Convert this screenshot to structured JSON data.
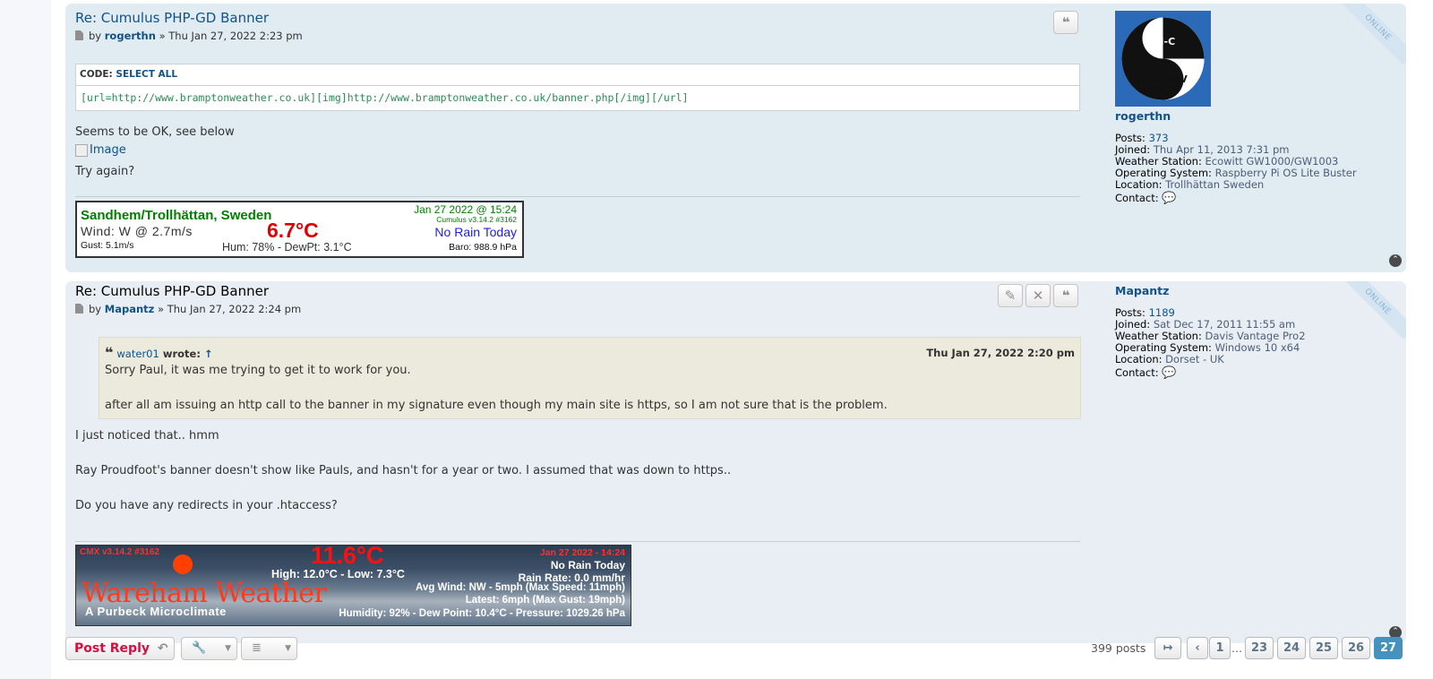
{
  "posts": [
    {
      "title": "Re: Cumulus PHP-GD Banner",
      "by": "by",
      "author": "rogerthn",
      "date": "» Thu Jan 27, 2022 2:23 pm",
      "code_label": "CODE:",
      "code_select": "SELECT ALL",
      "code": "[url=http://www.bramptonweather.co.uk][img]http://www.bramptonweather.co.uk/banner.php[/img][/url]",
      "line1": "Seems to be OK, see below",
      "image_alt": "Image",
      "line2": "Try again?",
      "banner": {
        "station": "Sandhem/Trollhättan, Sweden",
        "date": "Jan 27 2022 @ 15:24",
        "version": "Cumulus v3.14.2 #3162",
        "wind": "Wind: W @ 2.7m/s",
        "temp": "6.7°C",
        "rain": "No Rain Today",
        "gust": "Gust: 5.1m/s",
        "hum": "Hum: 78% - DewPt: 3.1°C",
        "baro": "Baro: 988.9 hPa"
      },
      "profile": {
        "username": "rogerthn",
        "avatar_top": "Ctrl-C",
        "avatar_bottom": "Ctrl-V",
        "posts_label": "Posts:",
        "posts": "373",
        "joined_label": "Joined:",
        "joined": "Thu Apr 11, 2013 7:31 pm",
        "station_label": "Weather Station:",
        "station": "Ecowitt GW1000/GW1003",
        "os_label": "Operating System:",
        "os": "Raspberry Pi OS Lite Buster",
        "location_label": "Location:",
        "location": "Trollhättan Sweden",
        "contact_label": "Contact:"
      },
      "online": "ONLINE"
    },
    {
      "title": "Re: Cumulus PHP-GD Banner",
      "by": "by",
      "author": "Mapantz",
      "date": "» Thu Jan 27, 2022 2:24 pm",
      "quote": {
        "author": "water01",
        "wrote": "wrote:",
        "arrow": "↑",
        "date": "Thu Jan 27, 2022 2:20 pm",
        "line1": "Sorry Paul, it was me trying to get it to work for you.",
        "line2": "after all am issuing an http call to the banner in my signature even though my main site is https, so I am not sure that is the problem."
      },
      "line1": "I just noticed that.. hmm",
      "line2": "Ray Proudfoot's banner doesn't show like Pauls, and hasn't for a year or two. I assumed that was down to https..",
      "line3": "Do you have any redirects in your .htaccess?",
      "banner": {
        "version": "CMX v3.14.2 #3162",
        "temp": "11.6°C",
        "date": "Jan 27 2022 - 14:24",
        "rain": "No Rain Today",
        "highlow": "High: 12.0°C - Low: 7.3°C",
        "rainrate": "Rain Rate: 0.0 mm/hr",
        "name": "Wareham Weather",
        "wind": "Avg Wind: NW - 5mph (Max Speed: 11mph)",
        "latest": "Latest: 6mph (Max Gust: 19mph)",
        "tagline": "A Purbeck Microclimate",
        "humidity": "Humidity: 92% - Dew Point: 10.4°C - Pressure: 1029.26 hPa"
      },
      "profile": {
        "username": "Mapantz",
        "posts_label": "Posts:",
        "posts": "1189",
        "joined_label": "Joined:",
        "joined": "Sat Dec 17, 2011 11:55 am",
        "station_label": "Weather Station:",
        "station": "Davis Vantage Pro2",
        "os_label": "Operating System:",
        "os": "Windows 10 x64",
        "location_label": "Location:",
        "location": "Dorset - UK",
        "contact_label": "Contact:"
      },
      "online": "ONLINE"
    }
  ],
  "action_bar": {
    "post_reply": "Post Reply",
    "post_count": "399 posts"
  },
  "pagination": {
    "pages": [
      "1",
      "…",
      "23",
      "24",
      "25",
      "26",
      "27"
    ],
    "current": "27"
  }
}
